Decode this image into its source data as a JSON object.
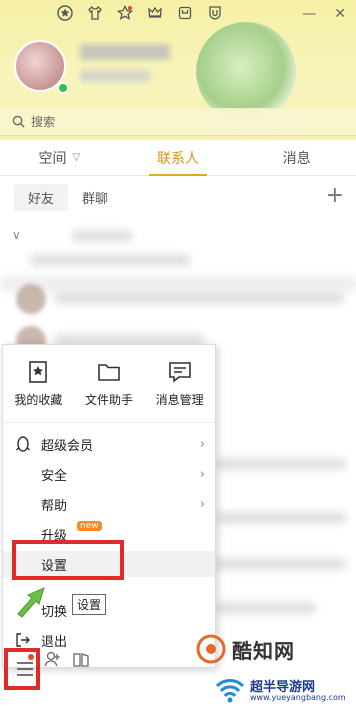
{
  "search": {
    "placeholder": "搜索"
  },
  "tabs": [
    {
      "label": "空间"
    },
    {
      "label": "联系人"
    },
    {
      "label": "消息"
    }
  ],
  "subtabs": [
    {
      "label": "好友"
    },
    {
      "label": "群聊"
    }
  ],
  "menu": {
    "top_items": [
      {
        "label": "我的收藏",
        "icon": "bookmark-icon"
      },
      {
        "label": "文件助手",
        "icon": "folder-icon"
      },
      {
        "label": "消息管理",
        "icon": "message-manage-icon"
      }
    ],
    "items": [
      {
        "label": "超级会员",
        "icon": "penguin-icon"
      },
      {
        "label": "安全",
        "icon": ""
      },
      {
        "label": "帮助",
        "icon": ""
      },
      {
        "label": "升级",
        "badge": "new"
      },
      {
        "label": "设置"
      },
      {
        "label": "切换"
      },
      {
        "label": "退出",
        "icon": "exit-icon"
      }
    ]
  },
  "tooltip": "设置",
  "watermark": {
    "text": "酷知网",
    "site_title": "超半导游网",
    "site_url": "www.yueyangbang.com"
  },
  "colors": {
    "header_bg": "#f6f0a6",
    "accent": "#d9951a",
    "highlight_box": "#e02b2b",
    "badge": "#f38b2b"
  }
}
